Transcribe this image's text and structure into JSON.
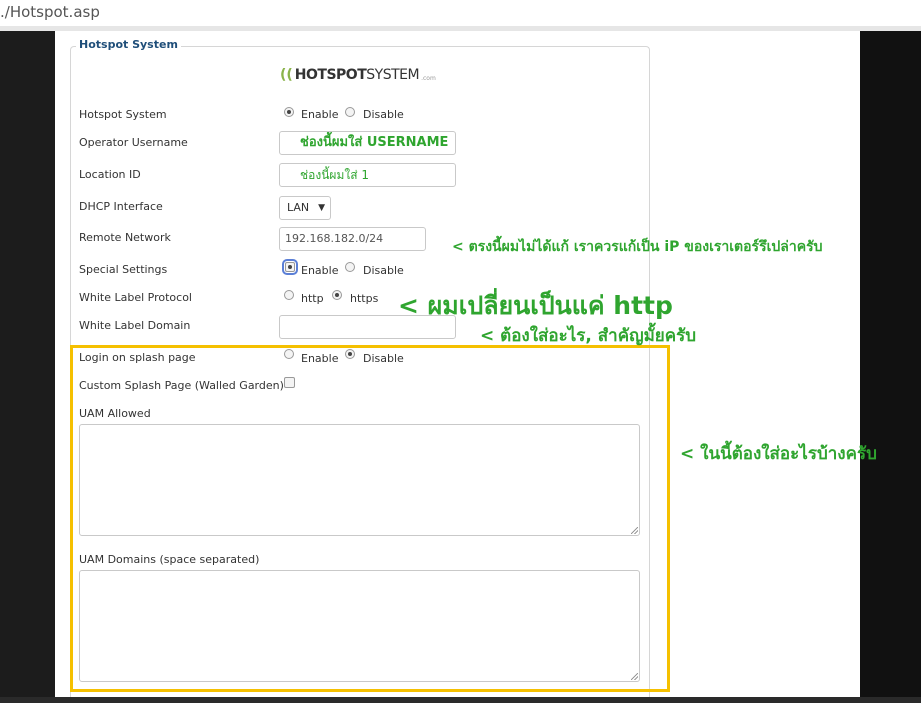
{
  "browser": {
    "url": "./Hotspot.asp"
  },
  "form": {
    "legend": "Hotspot System",
    "logo": {
      "part1": "HOTSPOT",
      "part2": "SYSTEM",
      "part3": ".com"
    },
    "hotspot_system": {
      "label": "Hotspot System",
      "options": [
        "Enable",
        "Disable"
      ],
      "selected": "Enable"
    },
    "operator_username": {
      "label": "Operator Username",
      "value": "ช่องนี้ผมใส่ USERNAME"
    },
    "location_id": {
      "label": "Location ID",
      "value": "ช่องนี้ผมใส่ 1"
    },
    "dhcp_interface": {
      "label": "DHCP Interface",
      "value": "LAN"
    },
    "remote_network": {
      "label": "Remote Network",
      "value": "192.168.182.0/24"
    },
    "special_settings": {
      "label": "Special Settings",
      "options": [
        "Enable",
        "Disable"
      ],
      "selected": "Enable"
    },
    "white_label_protocol": {
      "label": "White Label Protocol",
      "options": [
        "http",
        "https"
      ],
      "selected": "https"
    },
    "white_label_domain": {
      "label": "White Label Domain",
      "value": ""
    },
    "login_on_splash": {
      "label": "Login on splash page",
      "options": [
        "Enable",
        "Disable"
      ],
      "selected": "Disable"
    },
    "custom_splash": {
      "label": "Custom Splash Page (Walled Garden)",
      "checked": false
    },
    "uam_allowed": {
      "label": "UAM Allowed",
      "value": ""
    },
    "uam_domains": {
      "label": "UAM Domains (space separated)",
      "value": ""
    }
  },
  "annotations": {
    "remote_network_note": "< ตรงนี้ผมไม่ได้แก้ เราควรแก้เป็น iP ของเราเตอร์รึเปล่าครับ",
    "protocol_note": "< ผมเปลี่ยนเป็นแค่ http",
    "domain_note": "< ต้องใส่อะไร, สำคัญมั้ยครับ",
    "uam_note": "< ในนี้ต้องใส่อะไรบ้างครับ"
  },
  "colors": {
    "annotation": "#2fa52f",
    "highlight": "#f5c000",
    "legend": "#1f4e79"
  }
}
